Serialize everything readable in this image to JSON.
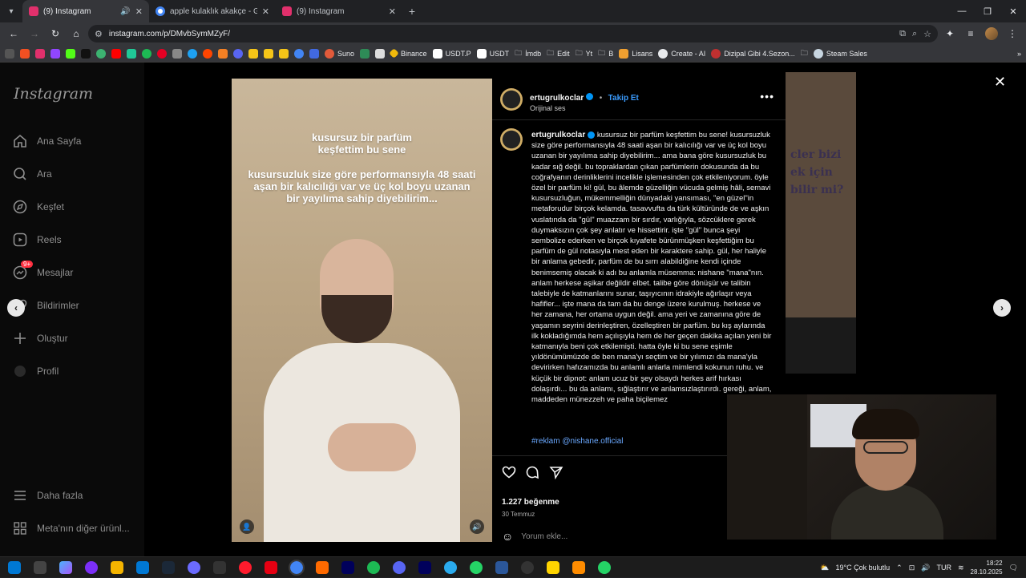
{
  "browser": {
    "tabs": [
      {
        "title": "(9) Instagram",
        "active": true,
        "favicon_color": "#e1306c"
      },
      {
        "title": "apple kulaklık akakçe - Google",
        "active": false,
        "favicon_color": "#4285f4"
      },
      {
        "title": "(9) Instagram",
        "active": false,
        "favicon_color": "#e1306c"
      }
    ],
    "url": "instagram.com/p/DMvbSymMZyF/",
    "bookmarks": [
      {
        "label": "Suno",
        "color": "#e25a3a"
      },
      {
        "label": "Binance",
        "color": "#f0b90b"
      },
      {
        "label": "USDT.P",
        "color": "#ffffff"
      },
      {
        "label": "USDT",
        "color": "#ffffff"
      },
      {
        "label": "İmdb",
        "color": "#9aa0a6"
      },
      {
        "label": "Edit",
        "color": "#9aa0a6"
      },
      {
        "label": "Yt",
        "color": "#9aa0a6"
      },
      {
        "label": "B",
        "color": "#9aa0a6"
      },
      {
        "label": "Lisans",
        "color": "#f0a030"
      },
      {
        "label": "Create - AI",
        "color": "#e8eaed"
      },
      {
        "label": "Dizipal Gibi 4.Sezon...",
        "color": "#c03030"
      },
      {
        "label": "Steam Sales",
        "color": "#c7d5e0"
      }
    ]
  },
  "sidebar": {
    "logo": "Instagram",
    "items": [
      {
        "label": "Ana Sayfa",
        "icon": "home-icon"
      },
      {
        "label": "Ara",
        "icon": "search-icon"
      },
      {
        "label": "Keşfet",
        "icon": "compass-icon"
      },
      {
        "label": "Reels",
        "icon": "reels-icon"
      },
      {
        "label": "Mesajlar",
        "icon": "messenger-icon",
        "badge": "9+"
      },
      {
        "label": "Bildirimler",
        "icon": "heart-icon"
      },
      {
        "label": "Oluştur",
        "icon": "plus-icon"
      },
      {
        "label": "Profil",
        "icon": "profile-icon"
      }
    ],
    "bottom": [
      {
        "label": "Daha fazla",
        "icon": "menu-icon"
      },
      {
        "label": "Meta'nın diğer ürünl...",
        "icon": "grid-icon"
      }
    ]
  },
  "background_card": {
    "lines": [
      "cler bizi",
      "ek için",
      "bilir mi?"
    ]
  },
  "media": {
    "headline": "kusursuz bir parfüm keşfettim bu sene",
    "subline": "kusursuzluk size göre performansıyla 48 saati aşan bir kalıcılığı var ve üç kol boyu uzanan bir yayılıma sahip diyebilirim..."
  },
  "post": {
    "username": "ertugrulkoclar",
    "follow_label": "Takip Et",
    "audio": "Orijinal ses",
    "caption_first": "kusursuz bir parfüm keşfettim bu sene!",
    "caption": "kusursuzluk size göre performansıyla 48 saati aşan bir kalıcılığı var ve üç kol boyu uzanan bir yayılıma sahip diyebilirim... ama bana göre kusursuzluk bu kadar sığ değil. bu topraklardan çıkan parfümlerin dokusunda da bu coğrafyanın derinliklerini incelikle işlemesinden çok etkileniyorum. öyle özel bir parfüm ki! gül, bu âlemde güzelliğin vücuda gelmiş hâli, semavi kusursuzluğun, mükemmelliğin dünyadaki yansıması, \"en güzel\"in metaforudur birçok kelamda. tasavvufta da türk kültüründe de ve aşkın vuslatında da \"gül\" muazzam bir sırdır, varlığıyla, sözcüklere gerek duymaksızın çok şey anlatır ve hissettirir. işte \"gül\" bunca şeyi sembolize ederken ve birçok kıyafete bürünmüşken keşfettiğim bu parfüm de gül notasıyla mest eden bir karaktere sahip. gül, her haliyle bir anlama gebedir, parfüm de bu sırrı alabildiğine kendi içinde benimsemiş olacak ki adı bu anlamla müsemma: nishane \"mana\"nın. anlam herkese aşikar değildir elbet. talibe göre dönüşür ve talibin talebiyle de katmanlarını sunar, taşıyıcının idrakiyle ağırlaşır veya hafifler... işte mana da tam da bu denge üzere kurulmuş. herkese ve her zamana, her ortama uygun değil. ama yeri ve zamanına göre de yaşamın seyrini derinleştiren, özelleştiren bir parfüm. bu kış aylarında ilk kokladığımda hem açılışıyla hem de her geçen dakika açılan yeni bir katmanıyla beni çok etkilemişti. hatta öyle ki bu sene eşimle yıldönümümüzde de ben mana'yı seçtim ve bir yılımızı da mana'yla devirirken hafızamızda bu anlamlı anlarla mimlendi kokunun ruhu. ve küçük bir dipnot: anlam ucuz bir şey olsaydı herkes arif hırkası dolaşırdı... bu da anlamı, sığlaştırır ve anlamsızlaştırırdı. gereği, anlam, maddeden münezzeh ve paha biçilemez",
    "hashtags": "#reklam @nishane.official",
    "likes": "1.227 beğenme",
    "date": "30 Temmuz",
    "comment_placeholder": "Yorum ekle..."
  },
  "taskbar": {
    "weather": "19°C  Çok bulutlu",
    "lang": "TUR",
    "time": "18:22",
    "date": "28.10.2025"
  },
  "colors": {
    "accent": "#0095f6",
    "link": "#6aa8ff",
    "badge": "#ff3040"
  }
}
